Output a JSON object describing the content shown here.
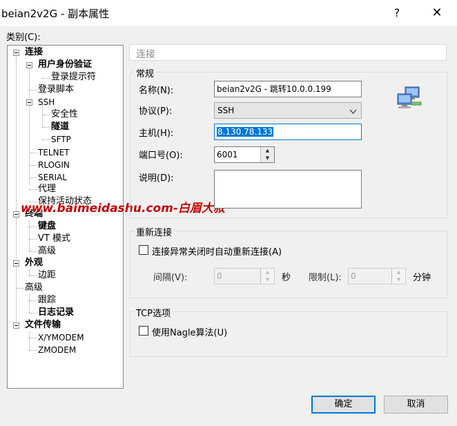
{
  "window": {
    "title": "beian2v2G - 副本属性",
    "help": "?",
    "close": "✕"
  },
  "category_label": "类别(C):",
  "tree": {
    "connection": "连接",
    "auth": "用户身份验证",
    "login_prompts": "登录提示符",
    "login_script": "登录脚本",
    "ssh": "SSH",
    "security": "安全性",
    "tunnel": "隧道",
    "sftp": "SFTP",
    "telnet": "TELNET",
    "rlogin": "RLOGIN",
    "serial": "SERIAL",
    "proxy": "代理",
    "keepalive": "保持活动状态",
    "terminal": "终端",
    "keyboard": "键盘",
    "vt_mode": "VT 模式",
    "advanced_term": "高级",
    "appearance": "外观",
    "margin": "边距",
    "advanced": "高级",
    "trace": "跟踪",
    "logging": "日志记录",
    "file_transfer": "文件传输",
    "xymodem": "X/YMODEM",
    "zmodem": "ZMODEM"
  },
  "panel": {
    "header": "连接",
    "general": {
      "title": "常规",
      "name_label": "名称(N):",
      "name_value": "beian2v2G - 跳转10.0.0.199",
      "protocol_label": "协议(P):",
      "protocol_value": "SSH",
      "host_label": "主机(H):",
      "host_value": "8.130.78.133",
      "port_label": "端口号(O):",
      "port_value": "6001",
      "desc_label": "说明(D):",
      "desc_value": ""
    },
    "reconnect": {
      "title": "重新连接",
      "auto_label": "连接异常关闭时自动重新连接(A)",
      "interval_label": "间隔(V):",
      "interval_value": "0",
      "seconds_unit": "秒",
      "limit_label": "限制(L):",
      "limit_value": "0",
      "minutes_unit": "分钟"
    },
    "tcp": {
      "title": "TCP选项",
      "nagle_label": "使用Nagle算法(U)"
    }
  },
  "buttons": {
    "ok": "确定",
    "cancel": "取消"
  },
  "watermark": "www.baimeidashu.com-白眉大叔",
  "colors": {
    "accent": "#0078d7",
    "watermark": "#c00000"
  }
}
